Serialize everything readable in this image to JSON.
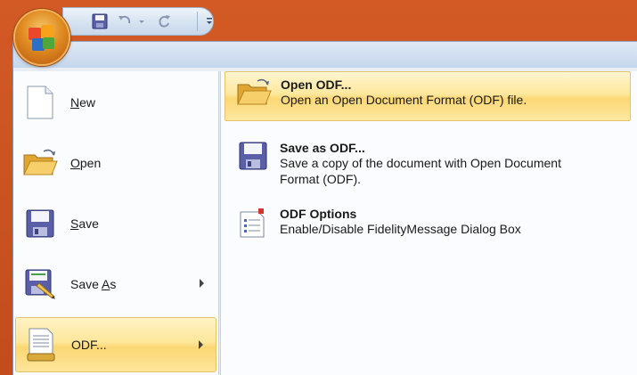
{
  "qat": {
    "items": [
      {
        "name": "save-icon"
      },
      {
        "name": "undo-icon"
      },
      {
        "name": "redo-icon"
      },
      {
        "name": "customize-qat-icon"
      }
    ]
  },
  "left_menu": {
    "items": [
      {
        "label": "New",
        "mnemonic": "N",
        "rest": "ew",
        "icon": "new-document-icon",
        "submenu": false
      },
      {
        "label": "Open",
        "mnemonic": "O",
        "rest": "pen",
        "icon": "open-folder-icon",
        "submenu": false
      },
      {
        "label": "Save",
        "mnemonic": "S",
        "rest": "ave",
        "icon": "save-disk-icon",
        "submenu": false
      },
      {
        "label": "Save As",
        "pre": "Save ",
        "mnemonic": "A",
        "rest": "s",
        "icon": "save-as-icon",
        "submenu": true
      },
      {
        "label": "ODF...",
        "icon": "odf-document-icon",
        "submenu": true
      }
    ]
  },
  "right_menu": {
    "items": [
      {
        "title": "Open ODF...",
        "desc": "Open an Open Document Format (ODF) file.",
        "icon": "open-folder-icon"
      },
      {
        "title": "Save as ODF...",
        "desc": "Save a copy of the document with Open Document Format (ODF).",
        "icon": "save-disk-icon"
      },
      {
        "title": "ODF Options",
        "desc": "Enable/Disable FidelityMessage Dialog Box",
        "icon": "options-document-icon"
      }
    ]
  }
}
